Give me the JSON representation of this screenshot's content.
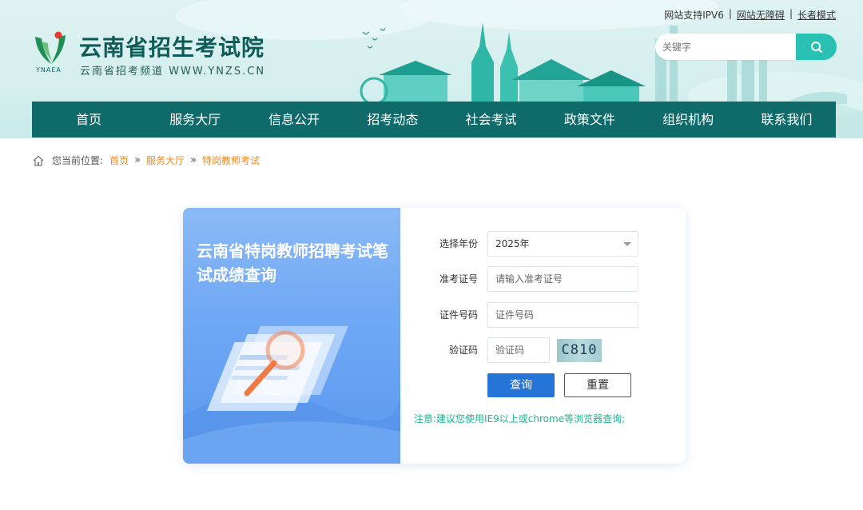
{
  "top_links": {
    "ipv6": "网站支持IPV6",
    "accessible": "网站无障碍",
    "elder_mode": "长者模式"
  },
  "site": {
    "logo_text": "YNAEA",
    "title": "云南省招生考试院",
    "subtitle": "云南省招考频道 WWW.YNZS.CN"
  },
  "search": {
    "placeholder": "关键字",
    "icon": "search-icon"
  },
  "nav": {
    "items": [
      "首页",
      "服务大厅",
      "信息公开",
      "招考动态",
      "社会考试",
      "政策文件",
      "组织机构",
      "联系我们"
    ]
  },
  "breadcrumb": {
    "prefix": "您当前位置:",
    "items": [
      "首页",
      "服务大厅",
      "特岗教师考试"
    ],
    "separator": "»"
  },
  "card": {
    "title": "云南省特岗教师招聘考试笔试成绩查询",
    "year_label": "选择年份",
    "year_value": "2025年",
    "exam_no_label": "准考证号",
    "exam_no_placeholder": "请输入准考证号",
    "id_label": "证件号码",
    "id_placeholder": "证件号码",
    "captcha_label": "验证码",
    "captcha_placeholder": "验证码",
    "captcha_text": "C810",
    "query_button": "查询",
    "reset_button": "重置",
    "notice": "注意:建议您使用IE9以上或chrome等浏览器查询;"
  },
  "colors": {
    "nav_bg": "#0f6a6a",
    "accent_teal": "#28c1b4",
    "query_blue": "#2575d8",
    "breadcrumb_link": "#f08a24",
    "notice_green": "#1fb38f"
  }
}
